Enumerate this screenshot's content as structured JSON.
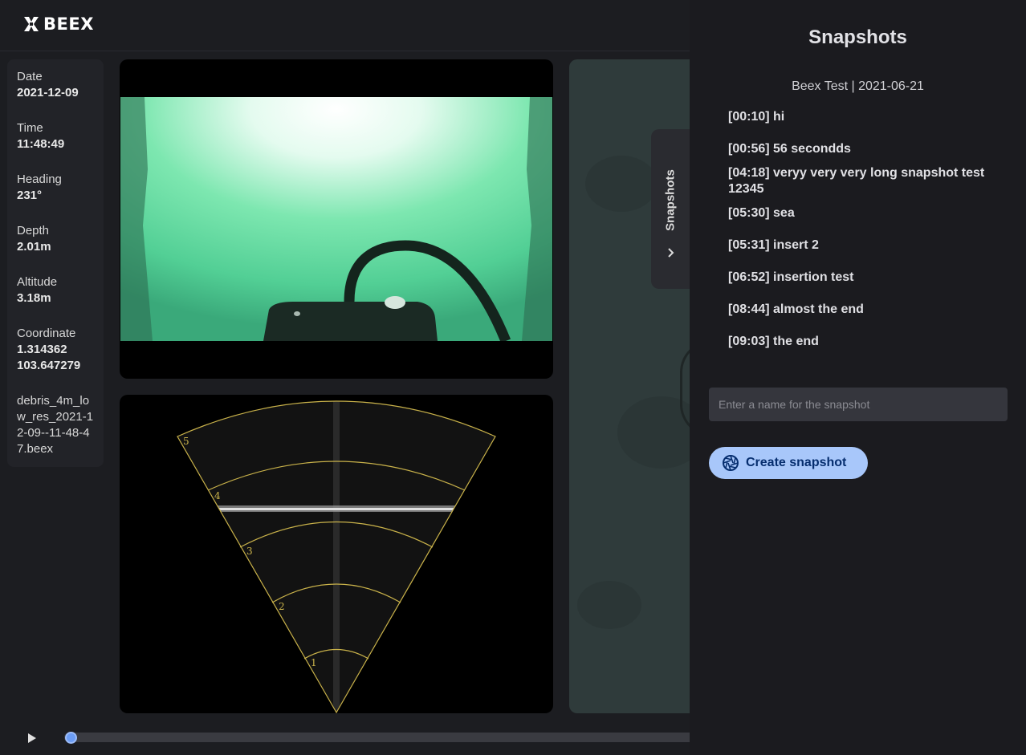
{
  "header": {
    "logo_text": "BEEX"
  },
  "telemetry": {
    "items": [
      {
        "label": "Date",
        "value": "2021-12-09"
      },
      {
        "label": "Time",
        "value": "11:48:49"
      },
      {
        "label": "Heading",
        "value": "231°"
      },
      {
        "label": "Depth",
        "value": "2.01m"
      },
      {
        "label": "Altitude",
        "value": "3.18m"
      },
      {
        "label": "Coordinate",
        "value": "1.314362",
        "value2": "103.647279"
      }
    ],
    "filename": "debris_4m_low_res_2021-12-09--11-48-47.beex"
  },
  "sonar": {
    "range_labels": [
      "1",
      "2",
      "3",
      "4",
      "5"
    ]
  },
  "side_tab": {
    "label": "Snapshots",
    "chevron_icon": "chevron-right-icon"
  },
  "timeline": {
    "play_icon": "play-icon",
    "progress": 0.0
  },
  "drawer": {
    "title": "Snapshots",
    "subtitle": "Beex Test | 2021-06-21",
    "snapshots": [
      "[00:10] hi",
      "[00:56] 56 secondds",
      "[04:18] veryy very very long snapshot test 12345",
      "[05:30] sea",
      "[05:31] insert 2",
      "[06:52] insertion test",
      "[08:44] almost the end",
      "[09:03] the end"
    ],
    "input_placeholder": "Enter a name for the snapshot",
    "input_value": "",
    "create_button": {
      "label": "Create snapshot",
      "icon": "camera-shutter-icon"
    }
  },
  "colors": {
    "background": "#1c1d21",
    "drawer": "#1b1b1f",
    "accent": "#a8c7fa",
    "accent_text": "#062e6f",
    "sonar_lines": "#c9b24a",
    "video_green": "#4fd89a"
  }
}
